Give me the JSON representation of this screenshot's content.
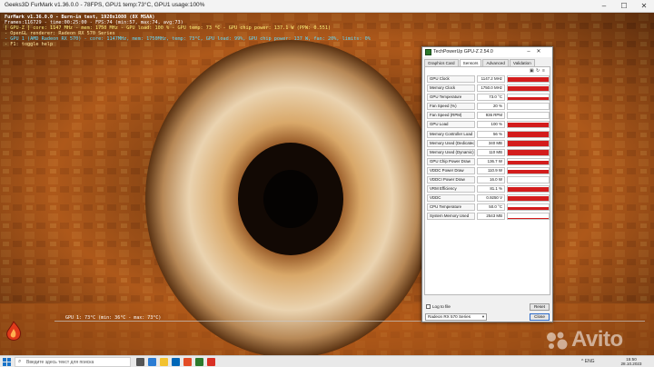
{
  "furmark": {
    "window_title": "Geeks3D FurMark v1.36.0.0 - 78FPS, GPU1 temp:73°C, GPU1 usage:100%",
    "overlay_lines": [
      "FurMark v1.36.0.0 - Burn-in test, 1920x1080 (8X MSAA)",
      "Frames:116729 - time:00:25:00 - FPS:74 (min:57, max:74, avg:73)",
      "[ GPU-Z ] core: 1147 MHz - mem: 1750 MHz - GPU load: 100 % - GPU temp: 73 °C - GPU chip power: 137.1 W (PPW: 0.551)",
      "- OpenGL renderer: Radeon RX 570 Series",
      "- GPU 1 (AMD Radeon RX 570) - core: 1147MHz, mem: 1750MHz, temp: 73°C, GPU load: 99%, GPU chip power: 137 W, fan: 20%, limits: 0%",
      "- F1: toggle help"
    ],
    "temp_graph_label": "GPU 1: 73°C (min: 36°C - max: 73°C)"
  },
  "gpuz": {
    "title": "TechPowerUp GPU-Z 2.54.0",
    "tabs": [
      "Graphics Card",
      "Sensors",
      "Advanced",
      "Validation"
    ],
    "active_tab": "Sensors",
    "rows": [
      {
        "name": "GPU Clock",
        "value": "1147.2 MHz",
        "fill": 0.85
      },
      {
        "name": "Memory Clock",
        "value": "1750.0 MHz",
        "fill": 0.9
      },
      {
        "name": "GPU Temperature",
        "value": "73.0 °C",
        "fill": 0.6
      },
      {
        "name": "Fan Speed (%)",
        "value": "20 %",
        "fill": 0.0
      },
      {
        "name": "Fan Speed (RPM)",
        "value": "936 RPM",
        "fill": 0.0
      },
      {
        "name": "GPU Load",
        "value": "100 %",
        "fill": 0.95
      },
      {
        "name": "Memory Controller Load",
        "value": "56 %",
        "fill": 0.9
      },
      {
        "name": "Memory Used (Dedicated)",
        "value": "340 MB",
        "fill": 0.9
      },
      {
        "name": "Memory Used (Dynamic)",
        "value": "110 MB",
        "fill": 0.9
      },
      {
        "name": "GPU Chip Power Draw",
        "value": "136.7 W",
        "fill": 0.7
      },
      {
        "name": "VDDC Power Draw",
        "value": "110.9 W",
        "fill": 0.65
      },
      {
        "name": "VDDCI Power Draw",
        "value": "16.0 W",
        "fill": 0.0
      },
      {
        "name": "VRM Efficiency",
        "value": "81.1 %",
        "fill": 0.85
      },
      {
        "name": "VDDC",
        "value": "0.9250 V",
        "fill": 0.8
      },
      {
        "name": "CPU Temperature",
        "value": "50.0 °C",
        "fill": 0.55
      },
      {
        "name": "System Memory Used",
        "value": "2543 MB",
        "fill": 0.2
      }
    ],
    "log_to_file_label": "Log to file",
    "reset_label": "Reset",
    "gpu_select_value": "Radeon RX 570 Series",
    "close_label": "Close",
    "accent_color": "#d31c1c"
  },
  "taskbar": {
    "search_placeholder": "Введите здесь текст для поиска",
    "tray_text": "^ ENG",
    "clock_time": "15:50",
    "clock_date": "28.10.2023"
  },
  "watermark": {
    "text": "Avito"
  }
}
